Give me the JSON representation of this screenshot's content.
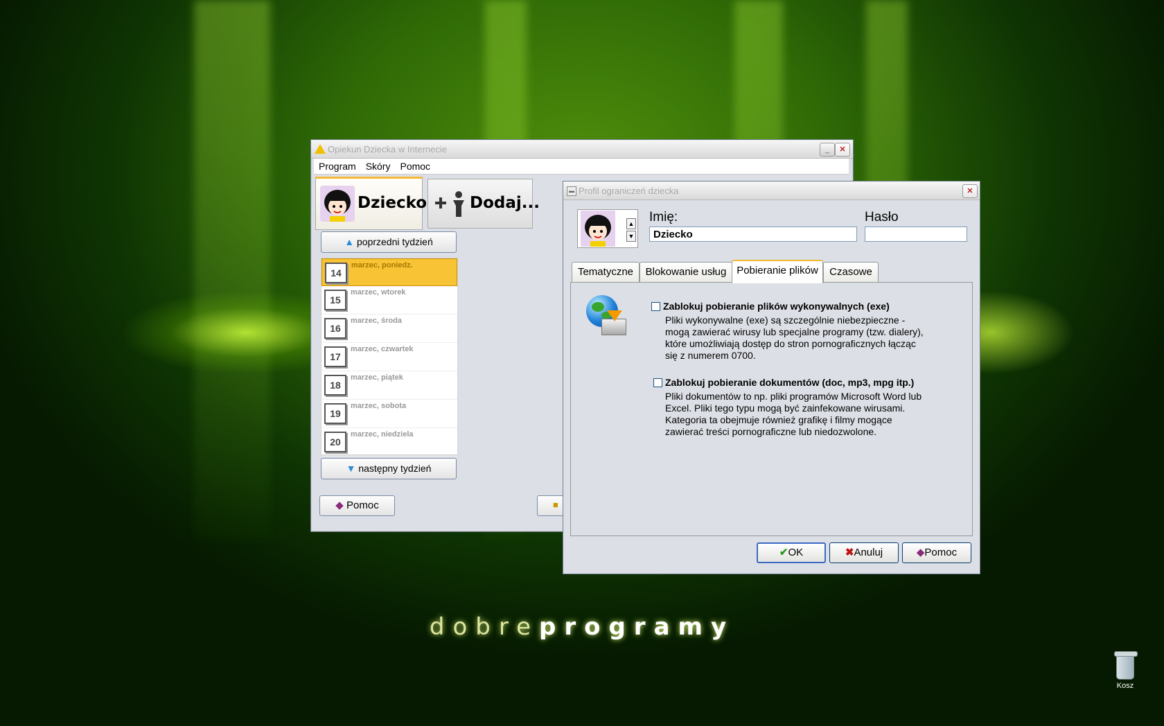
{
  "desktop": {
    "logo_light": "dobre",
    "logo_bold": "programy",
    "recycle_bin_label": "Kosz"
  },
  "main_window": {
    "title": "Opiekun Dziecka w Internecie",
    "menu": [
      "Program",
      "Skóry",
      "Pomoc"
    ],
    "child_tab_label": "Dziecko",
    "add_tab_label": "Dodaj...",
    "prev_week": "poprzedni tydzień",
    "next_week": "następny tydzień",
    "days": [
      {
        "num": "14",
        "label": "marzec, poniedz.",
        "active": true
      },
      {
        "num": "15",
        "label": "marzec, wtorek"
      },
      {
        "num": "16",
        "label": "marzec, środa"
      },
      {
        "num": "17",
        "label": "marzec, czwartek"
      },
      {
        "num": "18",
        "label": "marzec, piątek"
      },
      {
        "num": "19",
        "label": "marzec, sobota"
      },
      {
        "num": "20",
        "label": "marzec, niedziela"
      }
    ],
    "help_button": "Pomoc"
  },
  "dialog": {
    "title": "Profil ograniczeń dziecka",
    "name_label": "Imię:",
    "name_value": "Dziecko",
    "password_label": "Hasło",
    "password_value": "",
    "tabs": [
      "Tematyczne",
      "Blokowanie usług",
      "Pobieranie plików",
      "Czasowe"
    ],
    "selected_tab": "Pobieranie plików",
    "options": [
      {
        "title": "Zablokuj pobieranie plików wykonywalnych (exe)",
        "checked": false,
        "description": [
          "Pliki wykonywalne (exe) są szczególnie niebezpieczne -",
          "mogą zawierać wirusy lub specjalne programy (tzw. dialery),",
          "które umożliwiają dostęp do stron pornograficznych łącząc",
          "się z numerem 0700."
        ]
      },
      {
        "title": "Zablokuj pobieranie dokumentów (doc, mp3, mpg itp.)",
        "checked": false,
        "description": [
          "Pliki dokumentów to np. pliki programów Microsoft Word lub",
          "Excel. Pliki tego typu mogą być zainfekowane wirusami.",
          "Kategoria ta obejmuje również grafikę i filmy mogące",
          "zawierać treści pornograficzne lub niedozwolone."
        ]
      }
    ],
    "buttons": {
      "ok": "OK",
      "cancel": "Anuluj",
      "help": "Pomoc"
    }
  },
  "icons": [
    "warning-icon",
    "minimize-icon",
    "close-icon",
    "arrow-up-icon",
    "arrow-down-icon",
    "help-book-icon",
    "lock-icon",
    "globe-download-icon",
    "checkmark-icon",
    "x-icon",
    "recycle-bin-icon"
  ],
  "colors": {
    "active_day": "#f8c334",
    "tab_accent": "#f4b936",
    "window_bg": "#dcdfe5"
  }
}
